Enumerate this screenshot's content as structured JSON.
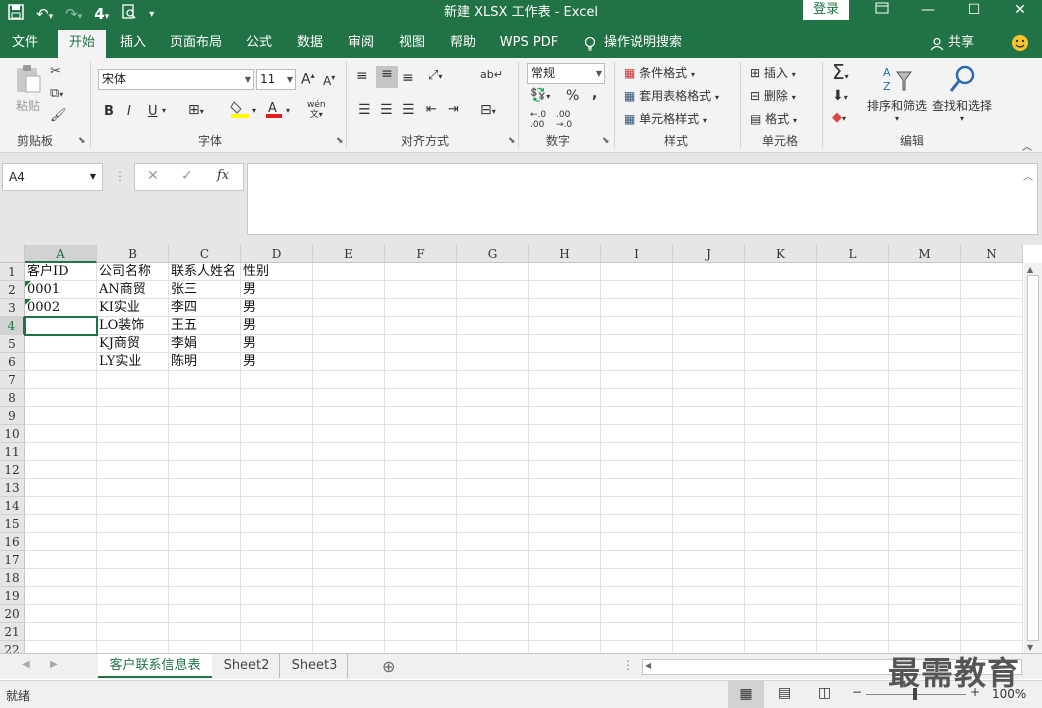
{
  "titlebar": {
    "title": "新建 XLSX 工作表 - Excel",
    "login": "登录",
    "qat_more": "▾"
  },
  "menu": {
    "tabs": [
      "文件",
      "开始",
      "插入",
      "页面布局",
      "公式",
      "数据",
      "审阅",
      "视图",
      "帮助",
      "WPS PDF"
    ],
    "search": "操作说明搜索",
    "share": "共享"
  },
  "ribbon": {
    "clipboard": {
      "label": "剪贴板",
      "paste": "粘贴"
    },
    "font": {
      "label": "字体",
      "name": "宋体",
      "size": "11",
      "bold": "B",
      "italic": "I",
      "underline": "U",
      "grow": "A",
      "shrink": "A",
      "wen": "wén"
    },
    "align": {
      "label": "对齐方式"
    },
    "number": {
      "label": "数字",
      "format": "常规",
      "percent": "%",
      "comma": ","
    },
    "styles": {
      "label": "样式",
      "conditional": "条件格式",
      "table": "套用表格格式",
      "cell": "单元格样式"
    },
    "cells": {
      "label": "单元格",
      "insert": "插入",
      "delete": "删除",
      "format": "格式"
    },
    "editing": {
      "label": "编辑",
      "sort": "排序和筛选",
      "find": "查找和选择"
    }
  },
  "formula": {
    "namebox": "A4",
    "value": ""
  },
  "grid": {
    "columns": [
      "A",
      "B",
      "C",
      "D",
      "E",
      "F",
      "G",
      "H",
      "I",
      "J",
      "K",
      "L",
      "M",
      "N"
    ],
    "rows": [
      "1",
      "2",
      "3",
      "4",
      "5",
      "6",
      "7",
      "8",
      "9",
      "10",
      "11",
      "12",
      "13",
      "14",
      "15",
      "16",
      "17",
      "18",
      "19",
      "20",
      "21",
      "22"
    ],
    "cells": [
      [
        "客户ID",
        "公司名称",
        "联系人姓名",
        "性别"
      ],
      [
        "0001",
        "AN商贸",
        "张三",
        "男"
      ],
      [
        "0002",
        "KI实业",
        "李四",
        "男"
      ],
      [
        "",
        "LO装饰",
        "王五",
        "男"
      ],
      [
        "",
        "KJ商贸",
        "李娟",
        "男"
      ],
      [
        "",
        "LY实业",
        "陈明",
        "男"
      ]
    ],
    "active": "A4"
  },
  "sheets": {
    "tabs": [
      "客户联系信息表",
      "Sheet2",
      "Sheet3"
    ],
    "active": 0
  },
  "status": {
    "ready": "就绪",
    "zoom": "100%"
  },
  "watermark": "最需教育",
  "colors": {
    "accent": "#217346"
  }
}
